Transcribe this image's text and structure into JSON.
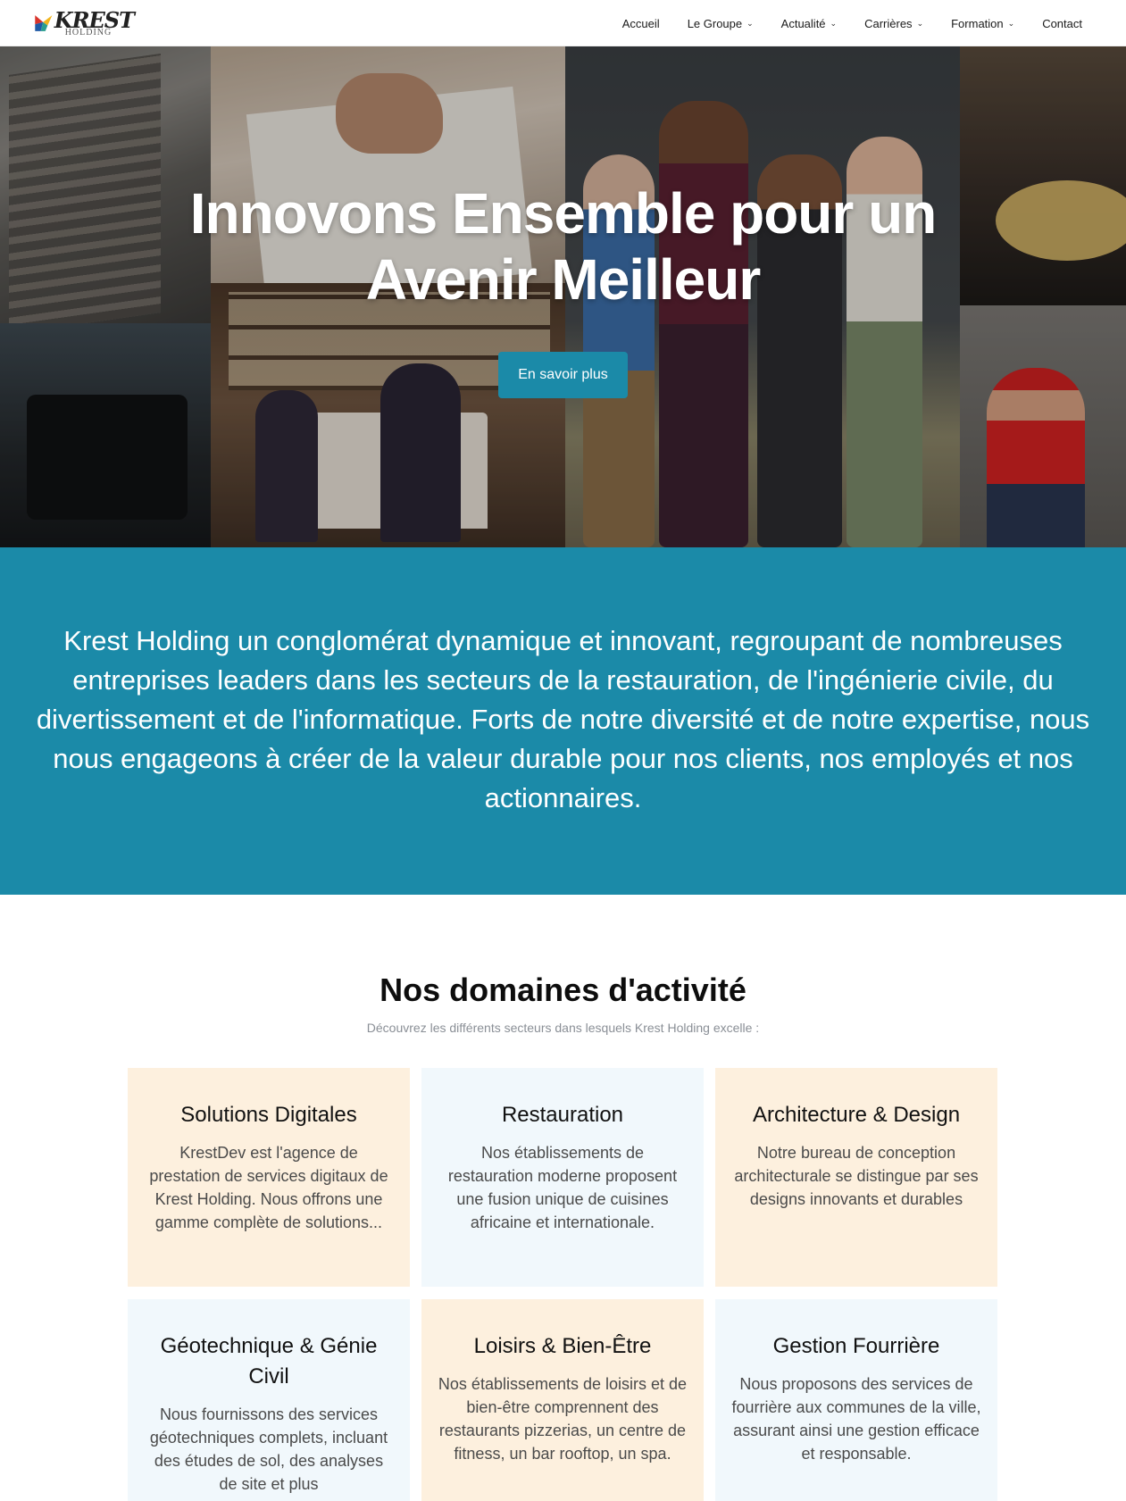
{
  "brand": {
    "name": "KREST",
    "sub": "HOLDING",
    "colors": {
      "red": "#d8342b",
      "blue": "#1f5aa6",
      "teal": "#1b8aa8"
    }
  },
  "nav": {
    "items": [
      {
        "label": "Accueil",
        "dropdown": false
      },
      {
        "label": "Le Groupe",
        "dropdown": true
      },
      {
        "label": "Actualité",
        "dropdown": true
      },
      {
        "label": "Carrières",
        "dropdown": true
      },
      {
        "label": "Formation",
        "dropdown": true
      },
      {
        "label": "Contact",
        "dropdown": false
      }
    ],
    "chevron": "⌄"
  },
  "hero": {
    "title_line1": "Innovons Ensemble pour un",
    "title_line2": "Avenir Meilleur",
    "button": "En savoir plus"
  },
  "intro": {
    "text": "Krest Holding un conglomérat dynamique et innovant, regroupant de nombreuses entreprises leaders dans les secteurs de la restauration, de l'ingénierie civile, du divertissement et de l'informatique. Forts de notre diversité et de notre expertise, nous nous engageons à créer de la valeur durable pour nos clients, nos employés et nos actionnaires."
  },
  "domains": {
    "title": "Nos domaines d'activité",
    "subtitle": "Découvrez les différents secteurs dans lesquels Krest Holding excelle :",
    "cards": [
      {
        "title": "Solutions Digitales",
        "text": "KrestDev est l'agence de prestation de services digitaux de Krest Holding. Nous offrons une gamme complète de solutions..."
      },
      {
        "title": "Restauration",
        "text": "Nos établissements de restauration moderne proposent une fusion unique de cuisines africaine et internationale."
      },
      {
        "title": "Architecture & Design",
        "text": "Notre bureau de conception architecturale se distingue par ses designs innovants et durables"
      },
      {
        "title": "Géotechnique & Génie Civil",
        "text": "Nous fournissons des services géotechniques complets, incluant des études de sol, des analyses de site et plus"
      },
      {
        "title": "Loisirs & Bien-Être",
        "text": "Nos établissements de loisirs et de bien-être comprennent des restaurants pizzerias, un centre de fitness, un bar rooftop, un spa."
      },
      {
        "title": "Gestion Fourrière",
        "text": "Nous proposons des services de fourrière aux communes de la ville, assurant ainsi une gestion efficace et responsable."
      }
    ]
  }
}
